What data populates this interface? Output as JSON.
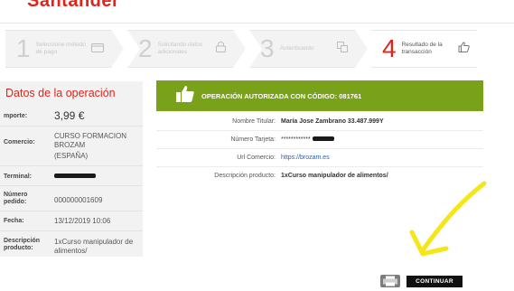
{
  "brand": {
    "logo_text": "Santander",
    "accent": "#e2231a"
  },
  "steps": [
    {
      "number": "1",
      "label": "Seleccione método de pago",
      "icon": "card-icon",
      "active": false
    },
    {
      "number": "2",
      "label": "Solicitando datos adicionales",
      "icon": "lock-icon",
      "active": false
    },
    {
      "number": "3",
      "label": "Autenticando",
      "icon": "device-icon",
      "active": false
    },
    {
      "number": "4",
      "label": "Resultado de la transacción",
      "icon": "thumbs-up-icon",
      "active": true
    }
  ],
  "operation": {
    "title": "Datos de la operación",
    "importe_label": "mporte:",
    "importe_value": "3,99 €",
    "comercio_label": "Comercio:",
    "comercio_value": "CURSO FORMACION BROZAM",
    "comercio_country": "(ESPAÑA)",
    "terminal_label": "Terminal:",
    "pedido_label": "Número pedido:",
    "pedido_value": "000000001609",
    "fecha_label": "Fecha:",
    "fecha_value": "13/12/2019  10:06",
    "descripcion_label": "Descripción producto:",
    "descripcion_value": "1xCurso manipulador de alimentos/"
  },
  "result": {
    "banner": "OPERACIÓN AUTORIZADA CON CÓDIGO: 081761",
    "banner_color": "#7aa11a",
    "titular_label": "Nombre Titular:",
    "titular_value": "María Jose Zambrano 33.487.999Y",
    "tarjeta_label": "Número Tarjeta:",
    "tarjeta_value": "************",
    "url_label": "Url Comercio:",
    "url_value": "https://brozam.es",
    "descripcion_label": "Descripción producto:",
    "descripcion_value": "1xCurso manipulador de alimentos/"
  },
  "actions": {
    "continue_label": "CONTINUAR",
    "print_icon": "printer-icon"
  }
}
